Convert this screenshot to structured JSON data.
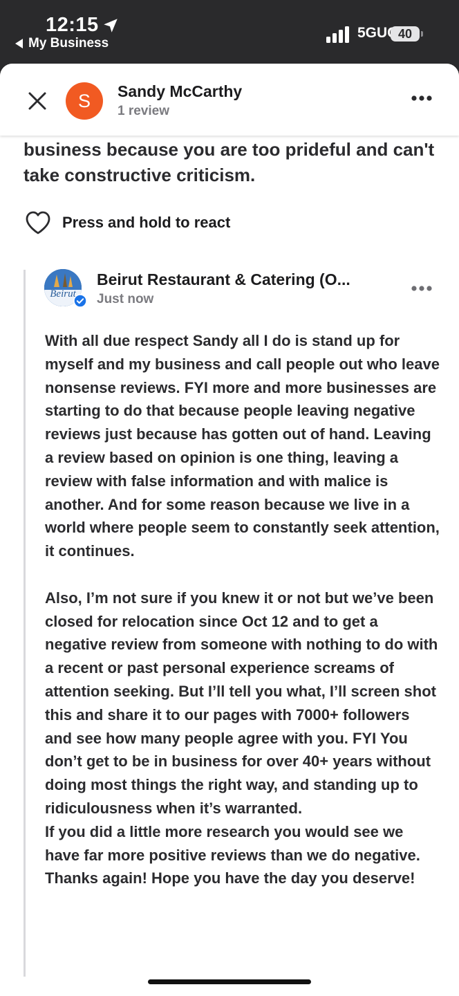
{
  "status_bar": {
    "time": "12:15",
    "back_app": "My Business",
    "network": "5GUC",
    "battery": "40"
  },
  "header": {
    "reviewer_initial": "S",
    "reviewer_name": "Sandy McCarthy",
    "review_count": "1 review",
    "avatar_color": "#f15a22"
  },
  "review": {
    "text_tail": "business because you are too prideful and can't take constructive criticism."
  },
  "react": {
    "label": "Press and hold to react"
  },
  "response": {
    "business_name": "Beirut Restaurant & Catering (O...",
    "timestamp": "Just now",
    "logo_text": "Beirut",
    "paragraphs": [
      "With all due respect Sandy all I do is stand up for myself and my business and call people out who leave nonsense reviews. FYI more and more businesses are starting to do that because people leaving negative reviews just because has gotten out of hand. Leaving a review based on opinion is one thing, leaving a review with false information and with malice is another. And for some reason because we live in a world where people seem to constantly seek attention, it continues.",
      "Also, I’m not sure if you knew it or not but we’ve been closed for relocation since Oct 12 and to get a negative review from someone with nothing to do with a recent or past personal experience screams of attention seeking.  But I’ll tell you what, I’ll screen shot this and share it to our pages with 7000+ followers and see how many people agree with you. FYI You don’t get to be in business for over 40+ years without doing most things the right way, and standing up to ridiculousness when it’s warranted.",
      "If you did a little more research you would see we have far more positive reviews than we do negative. Thanks again! Hope you have the day you deserve!"
    ]
  }
}
